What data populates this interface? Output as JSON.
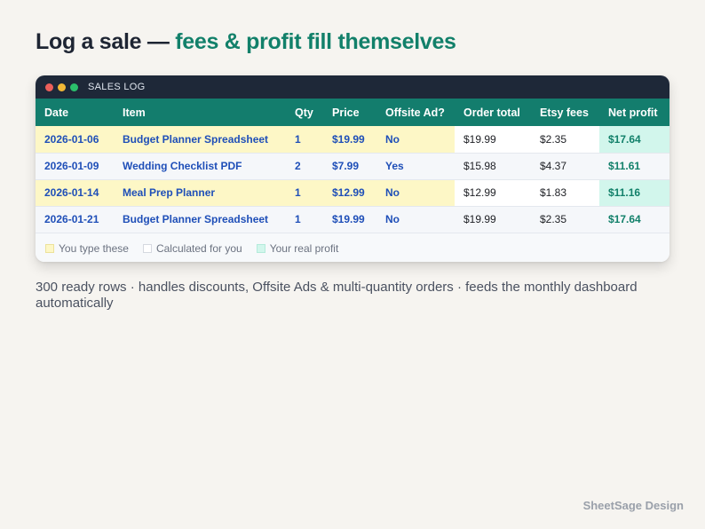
{
  "headline": {
    "main": "Log a sale — ",
    "accent": "fees & profit fill themselves"
  },
  "window": {
    "title": "SALES LOG"
  },
  "table": {
    "columns": [
      "Date",
      "Item",
      "Qty",
      "Price",
      "Offsite Ad?",
      "Order total",
      "Etsy fees",
      "Net profit"
    ],
    "rows": [
      {
        "date": "2026-01-06",
        "item": "Budget Planner Spreadsheet",
        "qty": "1",
        "price": "$19.99",
        "offsite": "No",
        "total": "$19.99",
        "fees": "$2.35",
        "profit": "$17.64"
      },
      {
        "date": "2026-01-09",
        "item": "Wedding Checklist PDF",
        "qty": "2",
        "price": "$7.99",
        "offsite": "Yes",
        "total": "$15.98",
        "fees": "$4.37",
        "profit": "$11.61"
      },
      {
        "date": "2026-01-14",
        "item": "Meal Prep Planner",
        "qty": "1",
        "price": "$12.99",
        "offsite": "No",
        "total": "$12.99",
        "fees": "$1.83",
        "profit": "$11.16"
      },
      {
        "date": "2026-01-21",
        "item": "Budget Planner Spreadsheet",
        "qty": "1",
        "price": "$19.99",
        "offsite": "No",
        "total": "$19.99",
        "fees": "$2.35",
        "profit": "$17.64"
      }
    ]
  },
  "legend": {
    "input": "You type these",
    "calculated": "Calculated for you",
    "profit": "Your real profit"
  },
  "caption": "300 ready rows · handles discounts, Offsite Ads & multi-quantity orders · feeds the monthly dashboard automatically",
  "brand": "SheetSage Design",
  "colors": {
    "background": "#f6f4f0",
    "accent": "#12806a",
    "header_bar": "#137d6d",
    "titlebar": "#1e2838",
    "input_text": "#1f4fb8",
    "input_fill": "#fdf7c6",
    "profit_fill": "#d2f6ec"
  }
}
